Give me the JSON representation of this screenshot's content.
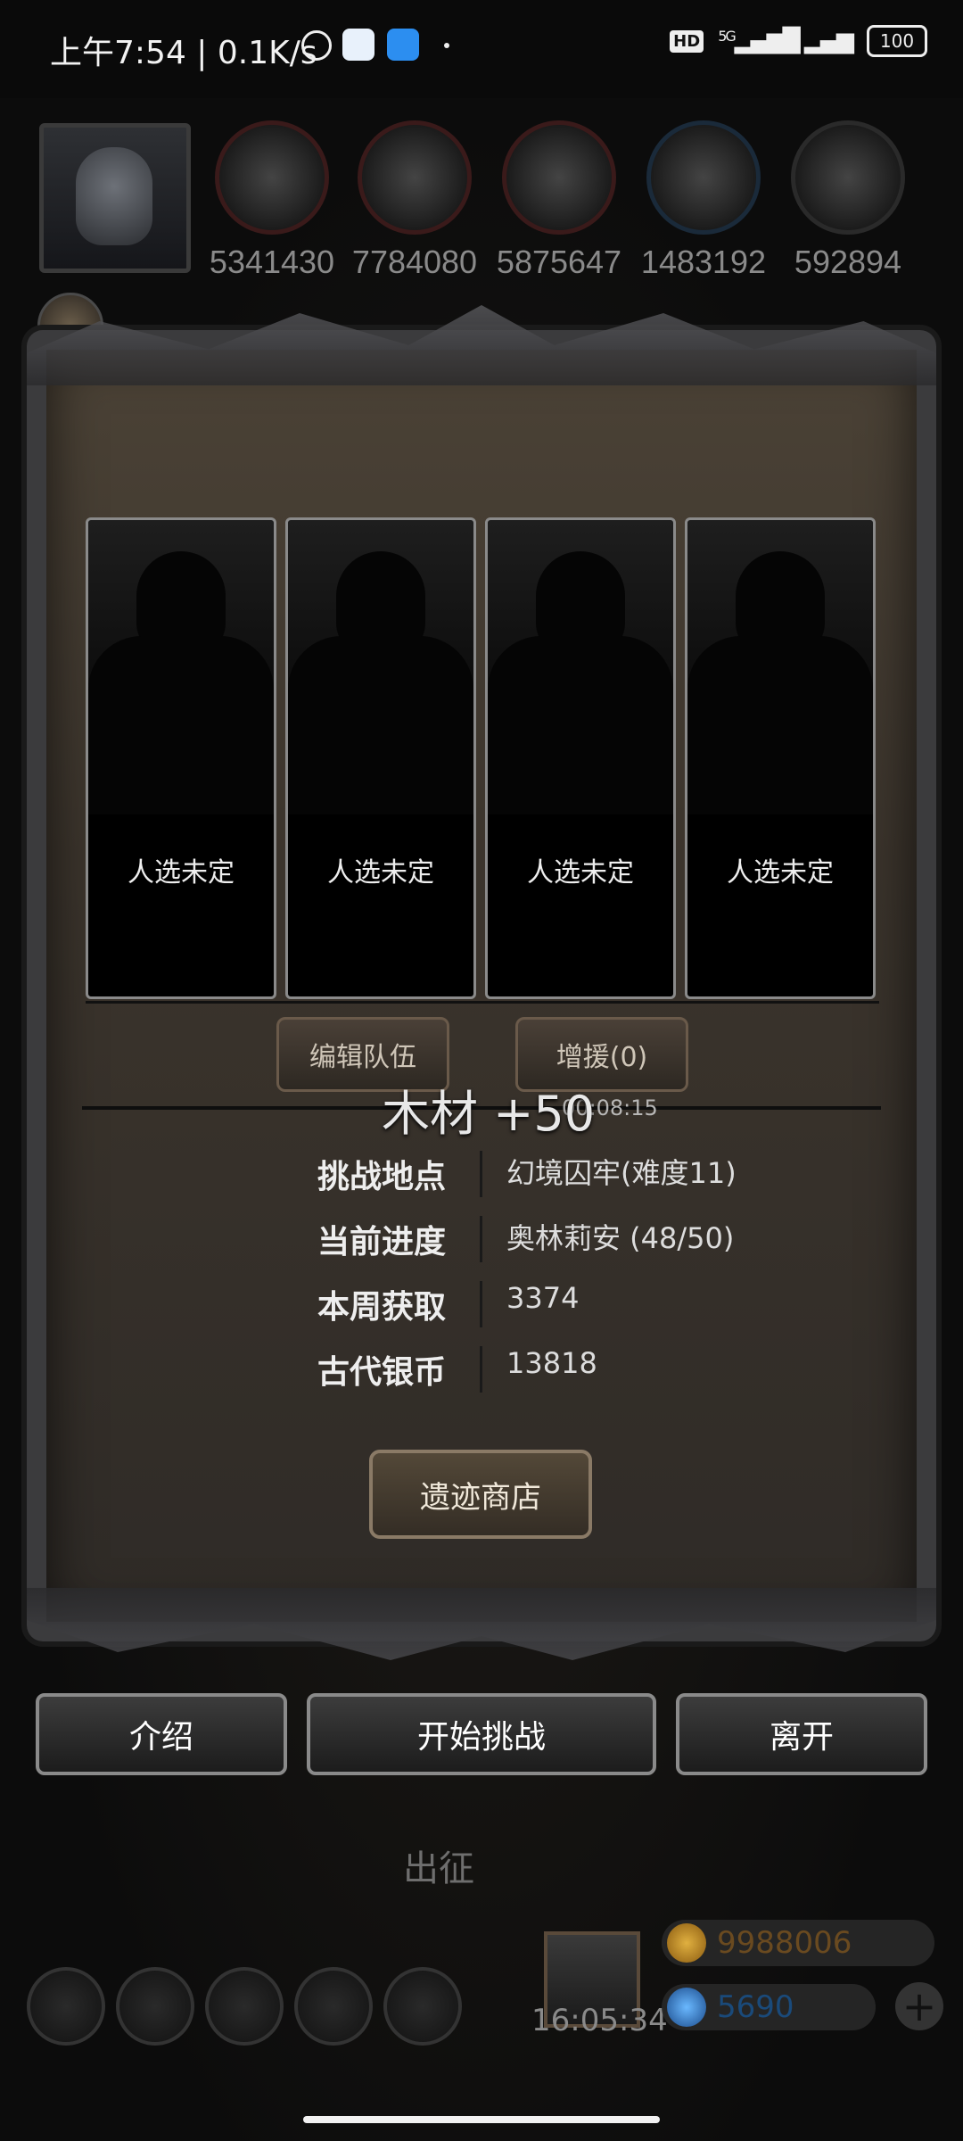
{
  "status_bar": {
    "time": "上午7:54 | 0.1K/s",
    "hd": "HD",
    "network": "5G",
    "battery": "100"
  },
  "resources": [
    "5341430",
    "7784080",
    "5875647",
    "1483192",
    "592894"
  ],
  "team": {
    "slots": [
      "人选未定",
      "人选未定",
      "人选未定",
      "人选未定"
    ],
    "edit_button": "编辑队伍",
    "reinforce_button": "增援(0)"
  },
  "toast": {
    "text": "木材 +50",
    "time": "00:08:15"
  },
  "info": [
    {
      "key": "挑战地点",
      "value": "幻境囚牢(难度11)"
    },
    {
      "key": "当前进度",
      "value": "奥林莉安 (48/50)"
    },
    {
      "key": "本周获取",
      "value": "3374"
    },
    {
      "key": "古代银币",
      "value": "13818"
    }
  ],
  "shop_button": "遗迹商店",
  "actions": {
    "intro": "介绍",
    "start": "开始挑战",
    "leave": "离开"
  },
  "background": {
    "chuzheng": "出征",
    "timer": "16:05:34",
    "gold": "9988006",
    "gems": "5690",
    "plus": "+"
  }
}
